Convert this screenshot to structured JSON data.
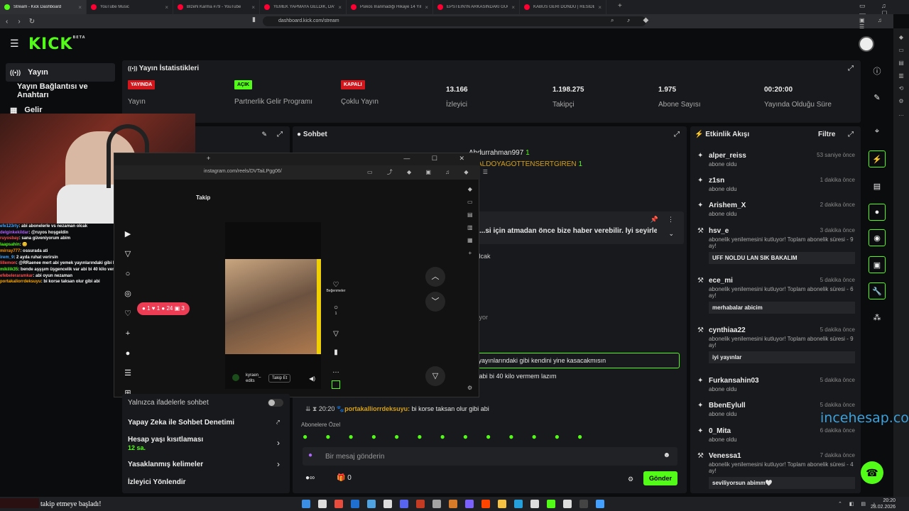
{
  "tabs": [
    {
      "label": "Stream - Kick Dashboard",
      "color": "#53fc18",
      "active": true
    },
    {
      "label": "YouTube Music",
      "color": "#ff0033"
    },
    {
      "label": "BİzeN Karma #79 - YouTube",
      "color": "#ff0033"
    },
    {
      "label": "YEMEK YAPMAYA GELDİK, DAYAK YE...",
      "color": "#ff0033"
    },
    {
      "label": "Psikos İnanmadığı Hikaye 14 Yıl Sonr...",
      "color": "#ff0033"
    },
    {
      "label": "EPSTEİN'İN ARKASINDAKİ GÜÇLER V...",
      "color": "#ff0033"
    },
    {
      "label": "KÂBUS GERİ DÖNDÜ | RESIDENT EVI...",
      "color": "#ff0033"
    }
  ],
  "url": "dashboard.kick.com/stream",
  "logo": "KICK",
  "logo_sup": "BETA",
  "nav": {
    "stream": "Yayın",
    "connection": "Yayın Bağlantısı ve Anahtarı",
    "income": "Gelir"
  },
  "stats": {
    "title": "Yayın İstatistikleri",
    "live_badge": "YAYINDA",
    "live_label": "Yayın",
    "partner_badge": "AÇIK",
    "partner_label": "Partnerlik Gelir Programı",
    "multi_badge": "KAPALI",
    "multi_label": "Çoklu Yayın",
    "viewers": "13.166",
    "viewers_label": "İzleyici",
    "followers": "1.198.275",
    "followers_label": "Takipçi",
    "subs": "1.975",
    "subs_label": "Abone Sayısı",
    "uptime": "00:20:00",
    "uptime_label": "Yayında Olduğu Süre"
  },
  "chat": {
    "title": "Sohbet",
    "user1": "Abdurrahman997",
    "user1_n": "1",
    "user2": "ALDOYAGOTTENSERTGIREN",
    "user2_n": "1",
    "pinned": "...si için atmadan önce bize haber verebilir. İyi seyirler!",
    "frag1": "...lcak",
    "frag2": "...yor",
    "highlight": "...yayınlarındaki gibi kendini yine kasacakmısın",
    "frag3": "...abi bi 40 kilo vermem lazım",
    "last_time": "20:20",
    "last_user": "portakalliorrdeksuyu:",
    "last_text": " bi korse taksan olur gibi abi",
    "emote_header": "Abonelere Özel",
    "placeholder": "Bir mesaj gönderin",
    "send": "Gönder",
    "count": "0"
  },
  "settings": {
    "emote_only": "Yalnızca ifadelerle sohbet",
    "ai_mod": "Yapay Zeka ile Sohbet Denetimi",
    "age": "Hesap yaşı kısıtlaması",
    "age_val": "12 sa.",
    "banned": "Yasaklanmış kelimeler",
    "redirect": "İzleyici Yönlendir"
  },
  "activity": {
    "title": "Etkinlik Akışı",
    "filter": "Filtre",
    "items": [
      {
        "name": "alper_reiss",
        "time": "53 saniye önce",
        "desc": "abone oldu"
      },
      {
        "name": "z1sn",
        "time": "1 dakika önce",
        "desc": "abone oldu"
      },
      {
        "name": "Arishem_X",
        "time": "2 dakika önce",
        "desc": "abone oldu"
      },
      {
        "name": "hsv_e",
        "time": "3 dakika önce",
        "desc": "abonelik yenilemesini kutluyor! Toplam abonelik süresi - 9 ay!",
        "msg": "UFF NOLDU LAN SIK BAKALIM"
      },
      {
        "name": "ece_mi",
        "time": "5 dakika önce",
        "desc": "abonelik yenilemesini kutluyor! Toplam abonelik süresi - 6 ay!",
        "msg": "merhabalar abicim"
      },
      {
        "name": "cynthiaa22",
        "time": "5 dakika önce",
        "desc": "abonelik yenilemesini kutluyor! Toplam abonelik süresi - 9 ay!",
        "msg": "iyi yayınlar"
      },
      {
        "name": "Furkansahin03",
        "time": "5 dakika önce",
        "desc": "abone oldu"
      },
      {
        "name": "BbenEylull",
        "time": "5 dakika önce",
        "desc": "abone oldu"
      },
      {
        "name": "0_Mita",
        "time": "6 dakika önce",
        "desc": "abone oldu"
      },
      {
        "name": "Venessa1",
        "time": "7 dakika önce",
        "desc": "abonelik yenilemesini kutluyor! Toplam abonelik süresi - 4 ay!",
        "msg": "seviliyorsun abimm🤍"
      }
    ]
  },
  "overlay_chat": [
    {
      "u": "efe123rty",
      "t": ": abi abonelerle vs nezaman olcak"
    },
    {
      "u": "delginkekildar",
      "t": ": @ruyos hoşgeldin"
    },
    {
      "u": "ruyosbay",
      "t": ": sana güveniyorum abim"
    },
    {
      "u": "laapsahin",
      "t": ": 😊"
    },
    {
      "u": "mirray777",
      "t": ": ossurada ati"
    },
    {
      "u": "irem_9",
      "t": ": 2 ayda ruhat verirsin"
    },
    {
      "u": "lillemon",
      "t": ": @RRaenee mert abi yemek yayınlarındaki gibi kendini yine kasacakmısın"
    },
    {
      "u": "mikilik35",
      "t": ": bende aşşşım üşgencelik var abi bi 40 kilo vermem lazım"
    },
    {
      "u": "efebeleraramkar",
      "t": ": abi oyun nezaman"
    },
    {
      "u": "portakaliorrdeksuyu",
      "t": ": bi korse taksan olur gibi abi"
    }
  ],
  "insta": {
    "url": "instagram.com/reels/DVTaiLPgg06/",
    "follow": "Takip",
    "likes": "Beğenmeler",
    "comments": "1",
    "author": "kyraen_ edits",
    "follow_btn": "Takip Et",
    "notif": {
      "comments": "1",
      "likes": "1",
      "follows": "24",
      "other": "3"
    }
  },
  "watermark": "incehesap.com",
  "bottom_text": "takip etmeye başladı!",
  "clock": "20:20",
  "date": "28.02.2026"
}
